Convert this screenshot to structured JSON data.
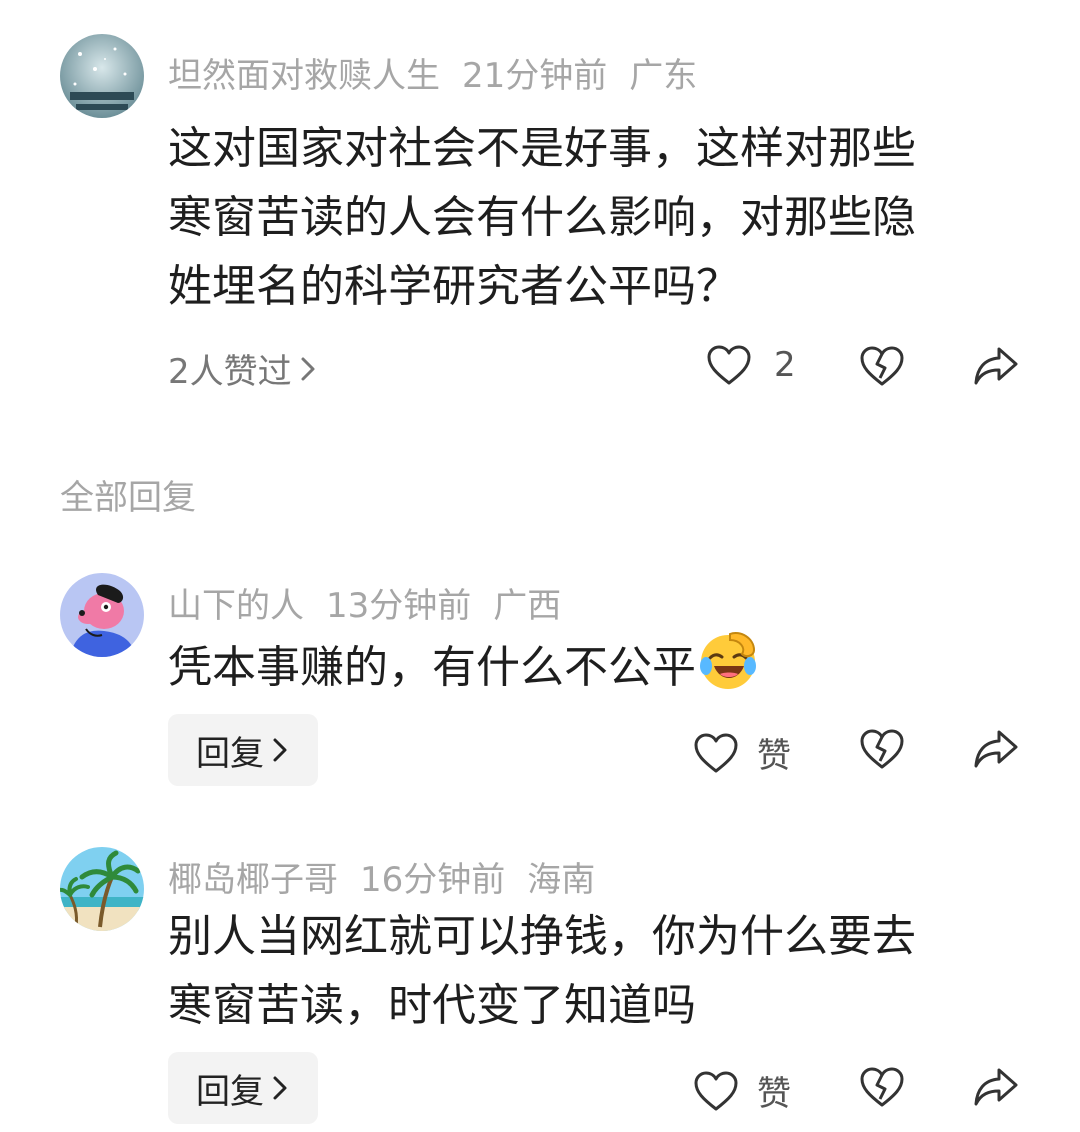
{
  "main_comment": {
    "user": "坦然面对救赎人生",
    "time": "21分钟前",
    "location": "广东",
    "lines": [
      "这对国家对社会不是好事，这样对那些",
      "寒窗苦读的人会有什么影响，对那些隐",
      "姓埋名的科学研究者公平吗？"
    ],
    "likers_text": "2人赞过",
    "like_count": "2"
  },
  "replies_section": {
    "title": "全部回复"
  },
  "replies": [
    {
      "user": "山下的人",
      "time": "13分钟前",
      "location": "广西",
      "lines": [
        "凭本事赚的，有什么不公平"
      ],
      "reply_label": "回复",
      "like_label": "赞"
    },
    {
      "user": "椰岛椰子哥",
      "time": "16分钟前",
      "location": "海南",
      "lines": [
        "别人当网红就可以挣钱，你为什么要去",
        "寒窗苦读，时代变了知道吗"
      ],
      "reply_label": "回复",
      "like_label": "赞"
    }
  ],
  "colors": {
    "meta_gray": "#a6a6a6",
    "reply_button_bg": "#f3f3f3"
  },
  "icons": [
    "heart-icon",
    "broken-heart-icon",
    "share-arrow-icon",
    "chevron-right-icon",
    "laughing-tears-emoji"
  ]
}
